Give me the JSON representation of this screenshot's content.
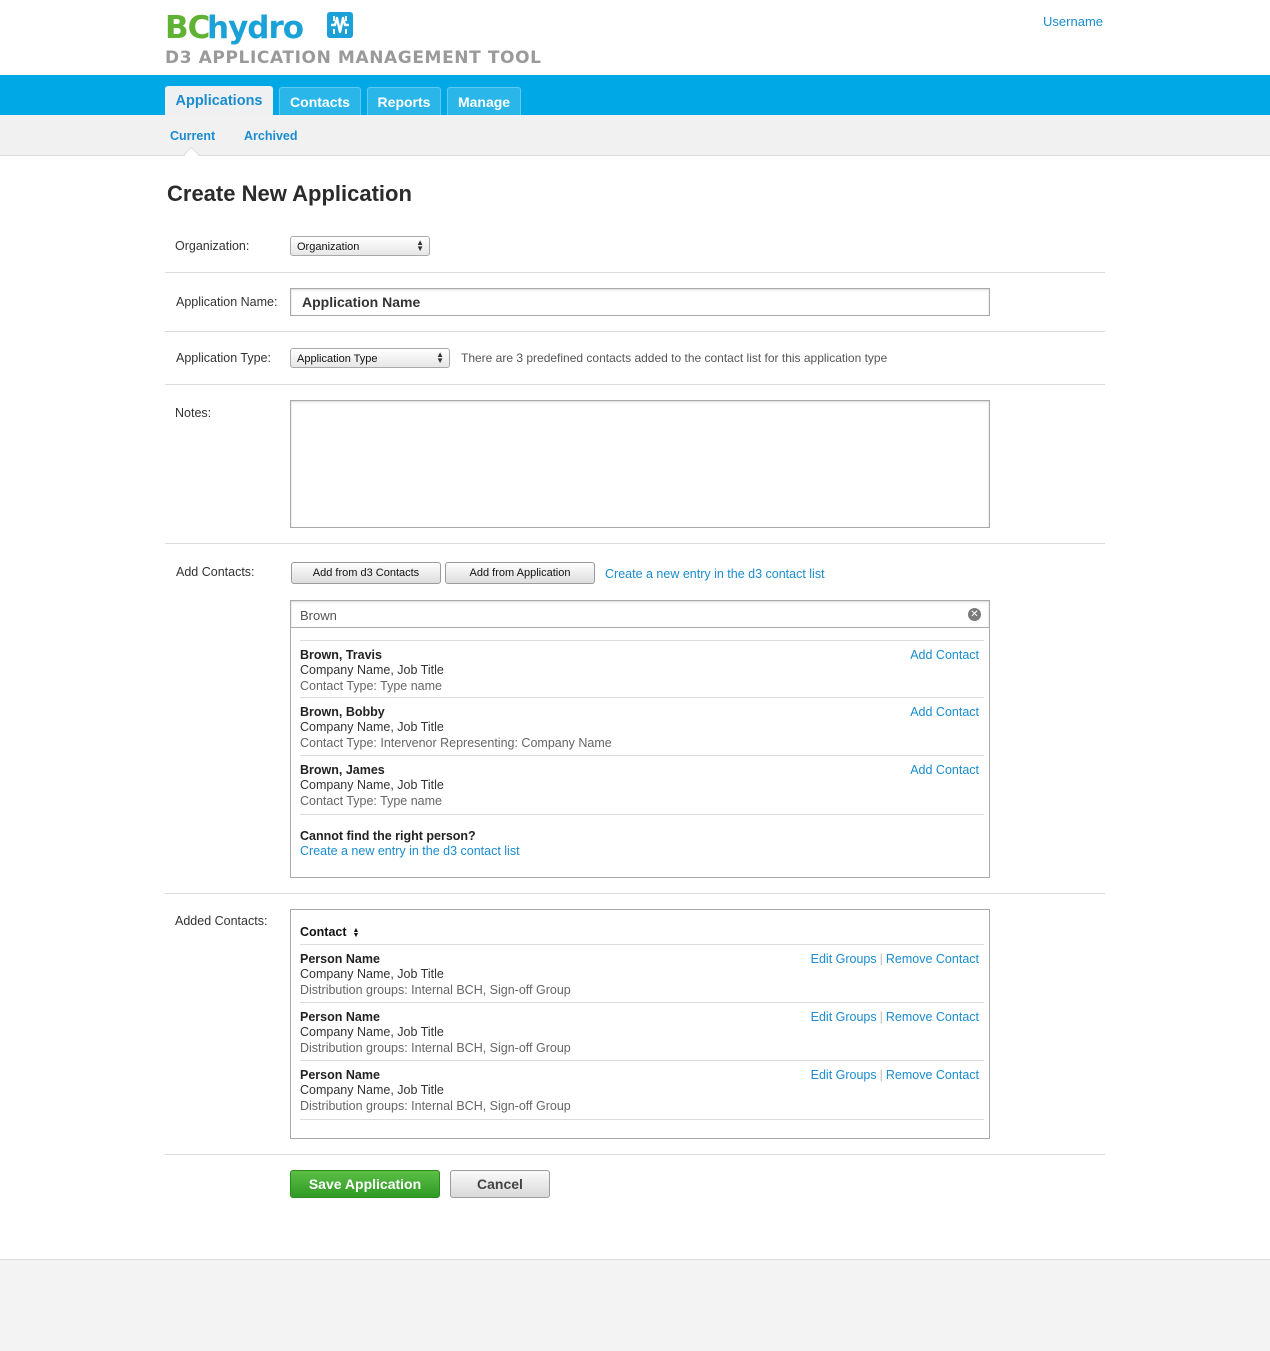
{
  "header": {
    "logo_bc": "BC",
    "logo_hydro": "hydro",
    "app_title": "D3 APPLICATION MANAGEMENT TOOL",
    "username": "Username"
  },
  "nav": {
    "tabs": [
      "Applications",
      "Contacts",
      "Reports",
      "Manage"
    ],
    "active_tab": "Applications",
    "subtabs": [
      "Current",
      "Archived"
    ]
  },
  "page": {
    "title": "Create New Application"
  },
  "form": {
    "organization_label": "Organization:",
    "organization_value": "Organization",
    "app_name_label": "Application Name:",
    "app_name_value": "Application Name",
    "app_type_label": "Application Type:",
    "app_type_value": "Application Type",
    "app_type_hint": "There are 3 predefined contacts added to the contact list for this application type",
    "notes_label": "Notes:",
    "notes_value": "",
    "add_contacts_label": "Add Contacts:",
    "add_from_d3": "Add from d3 Contacts",
    "add_from_app": "Add from Application",
    "create_entry": "Create a new entry in the d3 contact list",
    "search_value": "Brown",
    "added_contacts_label": "Added Contacts:"
  },
  "search_results": [
    {
      "name": "Brown, Travis",
      "company": "Company Name, Job Title",
      "type": "Contact Type: Type name",
      "action": "Add Contact"
    },
    {
      "name": "Brown, Bobby",
      "company": "Company Name, Job Title",
      "type": "Contact Type: Intervenor Representing: Company Name",
      "action": "Add Contact"
    },
    {
      "name": "Brown, James",
      "company": "Company Name, Job Title",
      "type": "Contact Type: Type name",
      "action": "Add Contact"
    }
  ],
  "not_found": {
    "question": "Cannot find the right person?",
    "link": "Create a new entry in the d3 contact list"
  },
  "added_contacts": {
    "column_header": "Contact",
    "edit_label": "Edit Groups",
    "remove_label": "Remove Contact",
    "rows": [
      {
        "name": "Person Name",
        "company": "Company Name, Job Title",
        "groups": "Distribution groups: Internal BCH, Sign-off Group"
      },
      {
        "name": "Person Name",
        "company": "Company Name, Job Title",
        "groups": "Distribution groups: Internal BCH, Sign-off Group"
      },
      {
        "name": "Person Name",
        "company": "Company Name, Job Title",
        "groups": "Distribution groups: Internal BCH, Sign-off Group"
      }
    ]
  },
  "actions": {
    "save": "Save Application",
    "cancel": "Cancel"
  },
  "colors": {
    "brand_blue": "#00a8e6",
    "brand_green": "#5fb233",
    "link": "#1a8ccf",
    "save_green": "#3fa82e"
  }
}
